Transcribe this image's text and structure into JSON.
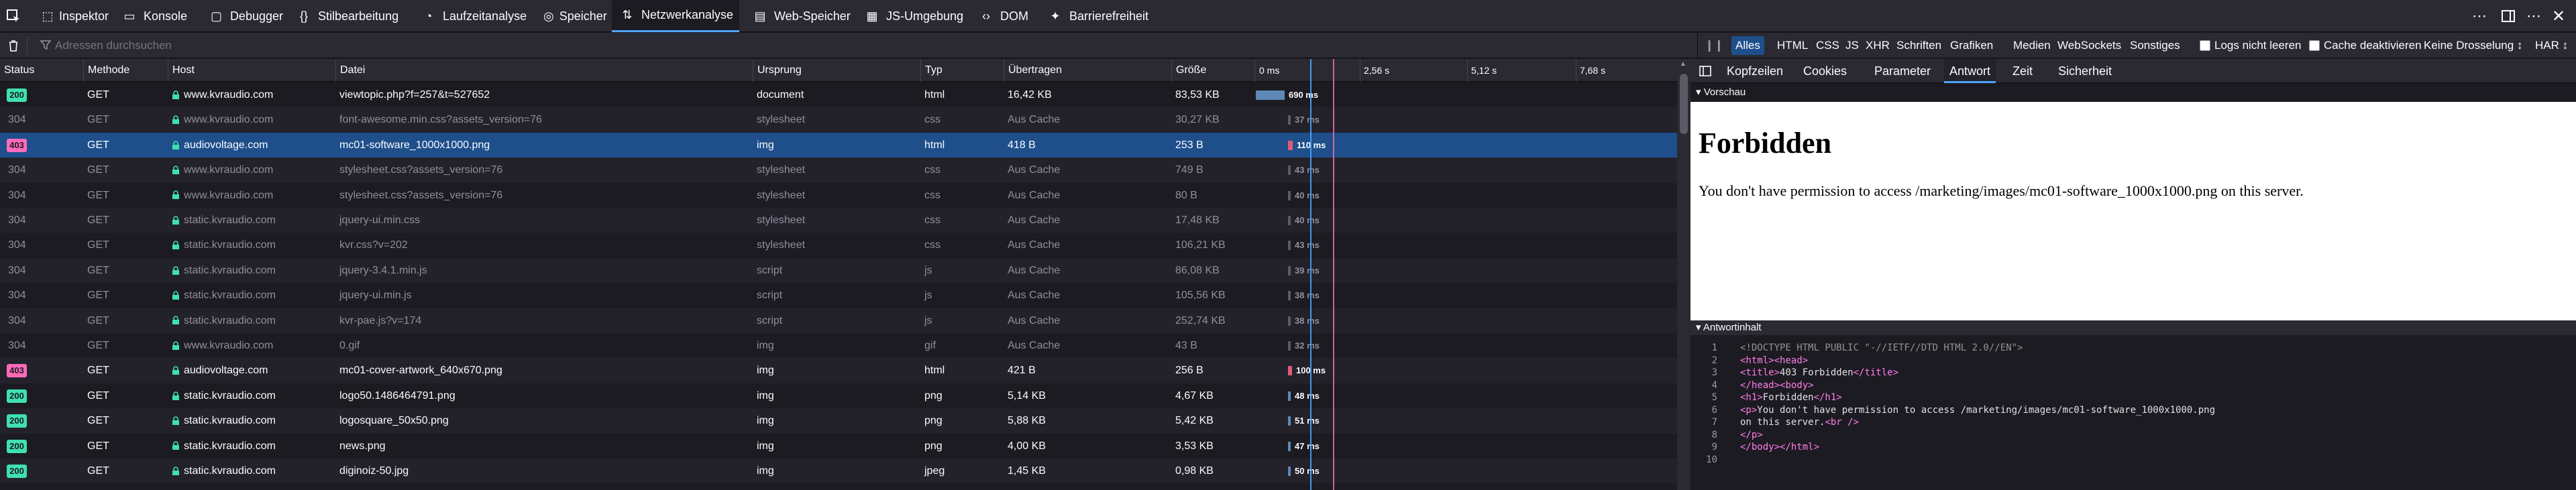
{
  "toolbar": {
    "tabs": [
      {
        "label": "Inspektor",
        "icon": "inspector-icon"
      },
      {
        "label": "Konsole",
        "icon": "console-icon"
      },
      {
        "label": "Debugger",
        "icon": "debugger-icon"
      },
      {
        "label": "Stilbearbeitung",
        "icon": "style-editor-icon"
      },
      {
        "label": "Laufzeitanalyse",
        "icon": "performance-icon"
      },
      {
        "label": "Speicher",
        "icon": "memory-icon"
      },
      {
        "label": "Netzwerkanalyse",
        "icon": "network-icon"
      },
      {
        "label": "Web-Speicher",
        "icon": "storage-icon"
      },
      {
        "label": "JS-Umgebung",
        "icon": "js-env-icon"
      },
      {
        "label": "DOM",
        "icon": "dom-icon"
      },
      {
        "label": "Barrierefreiheit",
        "icon": "accessibility-icon"
      }
    ],
    "selected": "Netzwerkanalyse"
  },
  "filter": {
    "placeholder": "Adressen durchsuchen",
    "types": [
      "Alles",
      "HTML",
      "CSS",
      "JS",
      "XHR",
      "Schriften",
      "Grafiken",
      "Medien",
      "WebSockets",
      "Sonstiges"
    ],
    "selected_type": "Alles",
    "persist_logs": "Logs nicht leeren",
    "disable_cache": "Cache deaktivieren",
    "throttling": "Keine Drosselung ↕",
    "har": "HAR ↕"
  },
  "columns": [
    "Status",
    "Methode",
    "Host",
    "Datei",
    "Ursprung",
    "Typ",
    "Übertragen",
    "Größe"
  ],
  "waterfall_ticks": [
    "0 ms",
    "2,56 s",
    "5,12 s",
    "7,68 s"
  ],
  "requests": [
    {
      "status": "200",
      "method": "GET",
      "host": "www.kvraudio.com",
      "file": "viewtopic.php?f=257&t=527652",
      "cause": "document",
      "type": "html",
      "transferred": "16,42 KB",
      "size": "83,53 KB",
      "time": "690 ms",
      "cached": false
    },
    {
      "status": "304",
      "method": "GET",
      "host": "www.kvraudio.com",
      "file": "font-awesome.min.css?assets_version=76",
      "cause": "stylesheet",
      "type": "css",
      "transferred": "Aus Cache",
      "size": "30,27 KB",
      "time": "37 ms",
      "cached": true
    },
    {
      "status": "403",
      "method": "GET",
      "host": "audiovoltage.com",
      "file": "mc01-software_1000x1000.png",
      "cause": "img",
      "type": "html",
      "transferred": "418 B",
      "size": "253 B",
      "time": "110 ms",
      "cached": false,
      "selected": true
    },
    {
      "status": "304",
      "method": "GET",
      "host": "www.kvraudio.com",
      "file": "stylesheet.css?assets_version=76",
      "cause": "stylesheet",
      "type": "css",
      "transferred": "Aus Cache",
      "size": "749 B",
      "time": "43 ms",
      "cached": true
    },
    {
      "status": "304",
      "method": "GET",
      "host": "www.kvraudio.com",
      "file": "stylesheet.css?assets_version=76",
      "cause": "stylesheet",
      "type": "css",
      "transferred": "Aus Cache",
      "size": "80 B",
      "time": "40 ms",
      "cached": true
    },
    {
      "status": "304",
      "method": "GET",
      "host": "static.kvraudio.com",
      "file": "jquery-ui.min.css",
      "cause": "stylesheet",
      "type": "css",
      "transferred": "Aus Cache",
      "size": "17,48 KB",
      "time": "40 ms",
      "cached": true
    },
    {
      "status": "304",
      "method": "GET",
      "host": "static.kvraudio.com",
      "file": "kvr.css?v=202",
      "cause": "stylesheet",
      "type": "css",
      "transferred": "Aus Cache",
      "size": "106,21 KB",
      "time": "43 ms",
      "cached": true
    },
    {
      "status": "304",
      "method": "GET",
      "host": "static.kvraudio.com",
      "file": "jquery-3.4.1.min.js",
      "cause": "script",
      "type": "js",
      "transferred": "Aus Cache",
      "size": "86,08 KB",
      "time": "39 ms",
      "cached": true
    },
    {
      "status": "304",
      "method": "GET",
      "host": "static.kvraudio.com",
      "file": "jquery-ui.min.js",
      "cause": "script",
      "type": "js",
      "transferred": "Aus Cache",
      "size": "105,56 KB",
      "time": "38 ms",
      "cached": true
    },
    {
      "status": "304",
      "method": "GET",
      "host": "static.kvraudio.com",
      "file": "kvr-pae.js?v=174",
      "cause": "script",
      "type": "js",
      "transferred": "Aus Cache",
      "size": "252,74 KB",
      "time": "38 ms",
      "cached": true
    },
    {
      "status": "304",
      "method": "GET",
      "host": "www.kvraudio.com",
      "file": "0.gif",
      "cause": "img",
      "type": "gif",
      "transferred": "Aus Cache",
      "size": "43 B",
      "time": "32 ms",
      "cached": true
    },
    {
      "status": "403",
      "method": "GET",
      "host": "audiovoltage.com",
      "file": "mc01-cover-artwork_640x670.png",
      "cause": "img",
      "type": "html",
      "transferred": "421 B",
      "size": "256 B",
      "time": "100 ms",
      "cached": false
    },
    {
      "status": "200",
      "method": "GET",
      "host": "static.kvraudio.com",
      "file": "logo50.1486464791.png",
      "cause": "img",
      "type": "png",
      "transferred": "5,14 KB",
      "size": "4,67 KB",
      "time": "48 ms",
      "cached": false
    },
    {
      "status": "200",
      "method": "GET",
      "host": "static.kvraudio.com",
      "file": "logosquare_50x50.png",
      "cause": "img",
      "type": "png",
      "transferred": "5,88 KB",
      "size": "5,42 KB",
      "time": "51 ms",
      "cached": false
    },
    {
      "status": "200",
      "method": "GET",
      "host": "static.kvraudio.com",
      "file": "news.png",
      "cause": "img",
      "type": "png",
      "transferred": "4,00 KB",
      "size": "3,53 KB",
      "time": "47 ms",
      "cached": false
    },
    {
      "status": "200",
      "method": "GET",
      "host": "static.kvraudio.com",
      "file": "diginoiz-50.jpg",
      "cause": "img",
      "type": "jpeg",
      "transferred": "1,45 KB",
      "size": "0,98 KB",
      "time": "50 ms",
      "cached": false
    }
  ],
  "side": {
    "tabs": [
      "Kopfzeilen",
      "Cookies",
      "Parameter",
      "Antwort",
      "Zeit",
      "Sicherheit"
    ],
    "selected": "Antwort",
    "preview_label": "Vorschau",
    "preview_heading": "Forbidden",
    "preview_text": "You don't have permission to access /marketing/images/mc01-software_1000x1000.png on this server.",
    "content_label": "Antwortinhalt",
    "code_lines": [
      "<!DOCTYPE HTML PUBLIC \"-//IETF//DTD HTML 2.0//EN\">",
      "<html><head>",
      "<title>403 Forbidden</title>",
      "</head><body>",
      "<h1>Forbidden</h1>",
      "<p>You don't have permission to access /marketing/images/mc01-software_1000x1000.png",
      "on this server.<br />",
      "</p>",
      "</body></html>",
      ""
    ]
  },
  "colors": {
    "accent": "#4fa4ff",
    "status_200": "#3fe1b0",
    "status_403": "#ff6bba",
    "selected_row": "#1e4f8b"
  }
}
